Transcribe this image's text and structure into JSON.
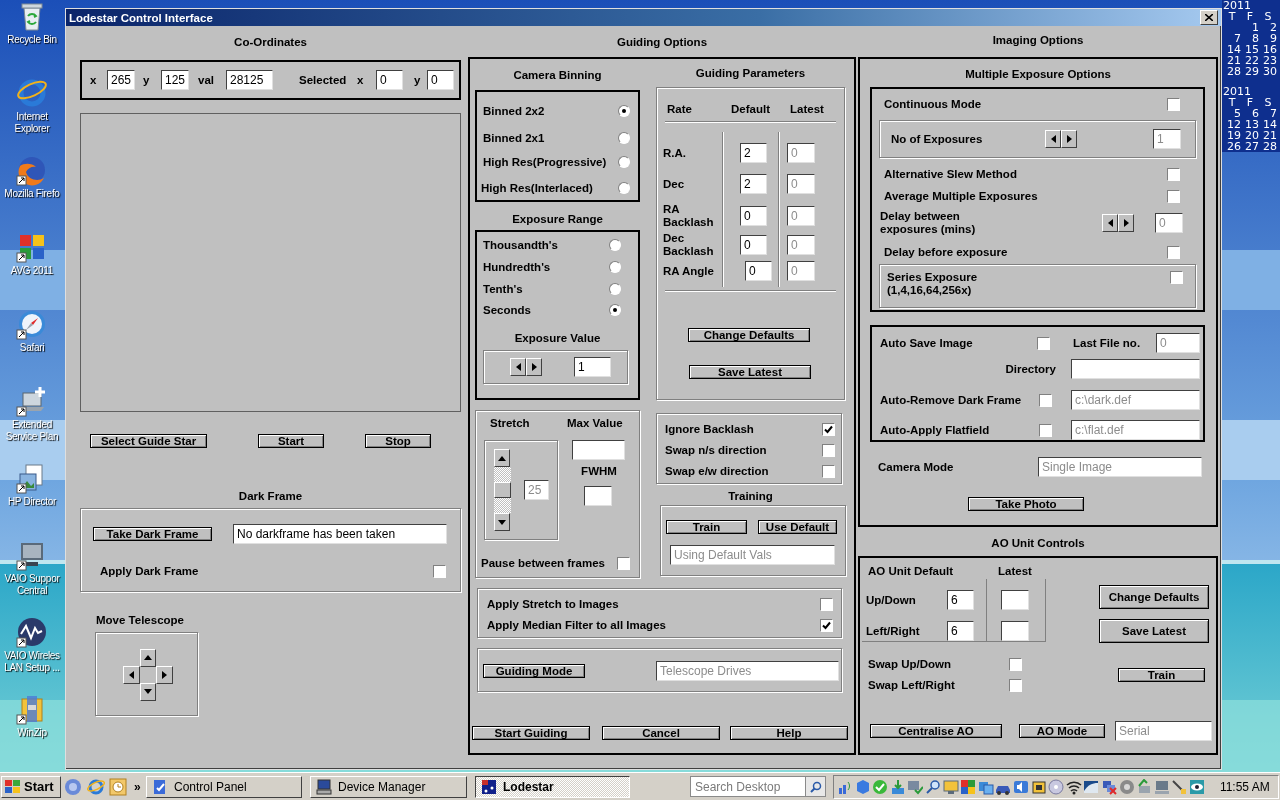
{
  "desktop": {
    "icons": [
      {
        "label": "Recycle Bin"
      },
      {
        "label": "Internet\nExplorer"
      },
      {
        "label": "Mozilla Firefo"
      },
      {
        "label": "AVG 2011"
      },
      {
        "label": "Safari"
      },
      {
        "label": "Extended\nService Plan"
      },
      {
        "label": "HP Director"
      },
      {
        "label": "VAIO Suppor\nCentral"
      },
      {
        "label": "VAIO Wireles\nLAN Setup ..."
      },
      {
        "label": "WinZip"
      }
    ]
  },
  "calendar": {
    "months": [
      {
        "year": "2011",
        "days": [
          "T",
          "F",
          "S"
        ],
        "weeks": [
          [
            "1",
            "2"
          ],
          [
            "7",
            "8",
            "9"
          ],
          [
            "14",
            "15",
            "16"
          ],
          [
            "21",
            "22",
            "23"
          ],
          [
            "28",
            "29",
            "30"
          ]
        ]
      },
      {
        "year": "2011",
        "days": [
          "T",
          "F",
          "S"
        ],
        "weeks": [
          [
            "5",
            "6",
            "7"
          ],
          [
            "12",
            "13",
            "14"
          ],
          [
            "19",
            "20",
            "21"
          ],
          [
            "26",
            "27",
            "28"
          ]
        ]
      }
    ]
  },
  "window": {
    "title": "Lodestar Control Interface"
  },
  "coordinates": {
    "title": "Co-Ordinates",
    "fields": [
      {
        "label": "x",
        "value": {
          "text": "265",
          "greyed": false
        }
      },
      {
        "label": "y",
        "value": {
          "text": "125",
          "greyed": false
        }
      },
      {
        "label": "val",
        "value": {
          "text": "28125",
          "greyed": false
        }
      }
    ],
    "selected_label": "Selected",
    "selected_fields": [
      {
        "label": "x",
        "value": {
          "text": "0",
          "greyed": false
        }
      },
      {
        "label": "y",
        "value": {
          "text": "0",
          "greyed": false
        }
      }
    ]
  },
  "left_buttons": [
    "Select Guide Star",
    "Start",
    "Stop"
  ],
  "dark_frame": {
    "title": "Dark Frame",
    "button": "Take Dark Frame",
    "status": {
      "text": "No darkframe has been taken",
      "greyed": false
    },
    "apply": {
      "label": "Apply Dark Frame",
      "checked": false
    }
  },
  "move_telescope": {
    "title": "Move Telescope"
  },
  "guiding_options": {
    "title": "Guiding Options",
    "camera_binning": {
      "title": "Camera Binning",
      "options": [
        {
          "label": "Binned 2x2",
          "selected": true
        },
        {
          "label": "Binned 2x1",
          "selected": false
        },
        {
          "label": "High Res(Progressive)",
          "selected": false
        },
        {
          "label": "High Res(Interlaced)",
          "selected": false
        }
      ]
    },
    "exposure_range": {
      "title": "Exposure Range",
      "options": [
        {
          "label": "Thousandth's",
          "selected": false
        },
        {
          "label": "Hundredth's",
          "selected": false
        },
        {
          "label": "Tenth's",
          "selected": false
        },
        {
          "label": "Seconds",
          "selected": true
        }
      ],
      "value_label": "Exposure Value",
      "value": {
        "text": "1",
        "greyed": false
      }
    },
    "guiding_parameters": {
      "title": "Guiding Parameters",
      "columns": [
        "Rate",
        "Default",
        "Latest"
      ],
      "rows": [
        {
          "label": "R.A.",
          "default": {
            "text": "2",
            "greyed": false
          },
          "latest": {
            "text": "0",
            "greyed": true
          }
        },
        {
          "label": "Dec",
          "default": {
            "text": "2",
            "greyed": false
          },
          "latest": {
            "text": "0",
            "greyed": true
          }
        },
        {
          "label": "RA\nBacklash",
          "default": {
            "text": "0",
            "greyed": false
          },
          "latest": {
            "text": "0",
            "greyed": true
          }
        },
        {
          "label": "Dec\nBacklash",
          "default": {
            "text": "0",
            "greyed": false
          },
          "latest": {
            "text": "0",
            "greyed": true
          }
        },
        {
          "label": "RA Angle",
          "default": {
            "text": "0",
            "greyed": false
          },
          "latest": {
            "text": "0",
            "greyed": true
          }
        }
      ],
      "buttons": [
        "Change Defaults",
        "Save Latest"
      ]
    },
    "stretch": {
      "title": "Stretch",
      "level": 0.5,
      "value": {
        "text": "25",
        "greyed": true
      },
      "max_value_label": "Max Value",
      "fwhm_label": "FWHM",
      "pause": {
        "label": "Pause between frames",
        "checked": false
      }
    },
    "direction_options": [
      {
        "label": "Ignore Backlash",
        "checked": true
      },
      {
        "label": "Swap n/s direction",
        "checked": false
      },
      {
        "label": "Swap e/w direction",
        "checked": false
      }
    ],
    "training": {
      "title": "Training",
      "buttons": [
        "Train",
        "Use Default"
      ],
      "status": {
        "text": "Using Default Vals",
        "greyed": true
      }
    },
    "image_options": [
      {
        "label": "Apply Stretch to Images",
        "checked": false
      },
      {
        "label": "Apply Median Filter to all Images",
        "checked": true
      }
    ],
    "guiding_mode": {
      "button": "Guiding Mode",
      "value": {
        "text": "Telescope Drives",
        "greyed": true
      }
    },
    "buttons": [
      "Start Guiding",
      "Cancel",
      "Help"
    ]
  },
  "imaging_options": {
    "title": "Imaging Options",
    "multiple_exposure": {
      "title": "Multiple Exposure Options",
      "rows": [
        {
          "kind": "check",
          "label": "Continuous Mode",
          "checked": false
        },
        {
          "kind": "spin",
          "boxed": true,
          "label": "No of Exposures",
          "value": {
            "text": "1",
            "greyed": true
          }
        },
        {
          "kind": "check",
          "label": "Alternative Slew Method",
          "checked": false
        },
        {
          "kind": "check",
          "label": "Average Multiple Exposures",
          "checked": false
        },
        {
          "kind": "spin",
          "boxed": false,
          "label": "Delay between\nexposures (mins)",
          "value": {
            "text": "0",
            "greyed": true
          }
        },
        {
          "kind": "check",
          "label": "Delay before exposure",
          "checked": false
        },
        {
          "kind": "check",
          "boxed": true,
          "label": "Series Exposure\n(1,4,16,64,256x)",
          "checked": false
        }
      ]
    },
    "auto_save": {
      "label": "Auto Save Image",
      "checked": false
    },
    "last_file": {
      "label": "Last File no.",
      "value": {
        "text": "0",
        "greyed": true
      }
    },
    "directory": {
      "label": "Directory"
    },
    "file_options": [
      {
        "label": "Auto-Remove Dark Frame",
        "checked": false,
        "value": {
          "text": "c:\\dark.def",
          "greyed": true
        }
      },
      {
        "label": "Auto-Apply Flatfield",
        "checked": false,
        "value": {
          "text": "c:\\flat.def",
          "greyed": true
        }
      }
    ],
    "camera_mode": {
      "label": "Camera Mode",
      "value": {
        "text": "Single Image",
        "greyed": true
      }
    },
    "take_photo": "Take Photo"
  },
  "ao_unit": {
    "title": "AO Unit Controls",
    "columns": [
      "AO Unit",
      "Default",
      "Latest"
    ],
    "rows": [
      {
        "label": "Up/Down",
        "default": {
          "text": "6",
          "greyed": false
        }
      },
      {
        "label": "Left/Right",
        "default": {
          "text": "6",
          "greyed": false
        }
      }
    ],
    "side_buttons": [
      "Change Defaults",
      "Save Latest"
    ],
    "swaps": [
      {
        "label": "Swap Up/Down",
        "checked": false
      },
      {
        "label": "Swap Left/Right",
        "checked": false
      }
    ],
    "train": "Train",
    "buttons": [
      "Centralise AO",
      "AO Mode"
    ],
    "mode": {
      "text": "Serial",
      "greyed": true
    }
  },
  "taskbar": {
    "start": "Start",
    "more": "»",
    "tasks": [
      {
        "label": "Control Panel",
        "selected": false
      },
      {
        "label": "Device Manager",
        "selected": false
      },
      {
        "label": "Lodestar",
        "selected": true
      }
    ],
    "search_placeholder": "Search Desktop",
    "clock": "11:55 AM"
  }
}
